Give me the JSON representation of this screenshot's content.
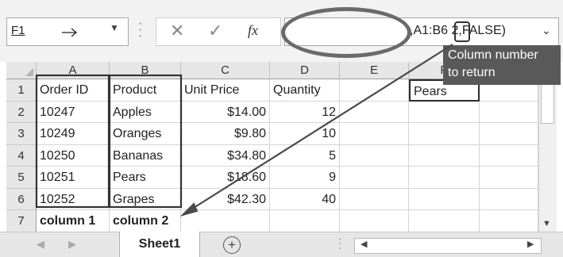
{
  "formula_bar": {
    "name_box": "F1",
    "name_dropdown_icon": "chevron-down-icon",
    "cancel_icon": "x-icon",
    "confirm_icon": "check-icon",
    "fx_label": "fx",
    "formula_visible": ",A1:B6 2,FALSE)",
    "formula_dropdown_icon": "chevron-down-icon"
  },
  "grid": {
    "columns": [
      "A",
      "B",
      "C",
      "D",
      "E",
      "F"
    ],
    "rows": [
      "1",
      "2",
      "3",
      "4",
      "5",
      "6",
      "7"
    ],
    "cells": {
      "A1": "Order ID",
      "B1": "Product",
      "C1": "Unit Price",
      "D1": "Quantity",
      "F1": "Pears",
      "A2": "10247",
      "B2": "Apples",
      "C2": "$14.00",
      "D2": "12",
      "A3": "10249",
      "B3": "Oranges",
      "C3": "$9.80",
      "D3": "10",
      "A4": "10250",
      "B4": "Bananas",
      "C4": "$34.80",
      "D4": "5",
      "A5": "10251",
      "B5": "Pears",
      "C5": "$18.60",
      "D5": "9",
      "A6": "10252",
      "B6": "Grapes",
      "C6": "$42.30",
      "D6": "40",
      "A7": "column 1",
      "B7": "column 2"
    },
    "selected_cell": "F1"
  },
  "annotation": {
    "callout_line1": "Column number",
    "callout_line2": "to return"
  },
  "tabs": {
    "sheet_name": "Sheet1",
    "add_sheet_label": "+"
  },
  "colors": {
    "header_bg": "#e6e6e6",
    "annotation_dark": "#595959"
  }
}
